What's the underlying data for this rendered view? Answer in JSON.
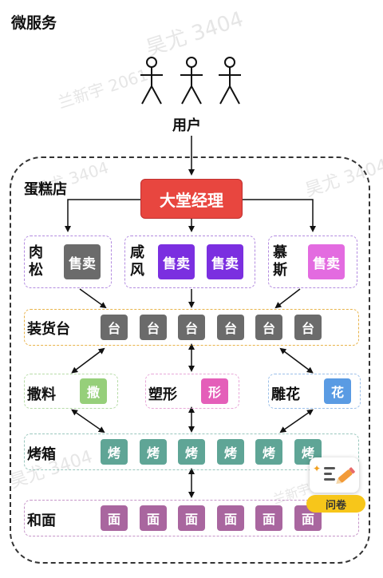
{
  "title": "微服务",
  "watermarks": [
    "昊尤 3404",
    "兰新宇 2061",
    "昊尤 3404",
    "昊尤 3404",
    "昊尤 3404",
    "兰新宇 2061"
  ],
  "users_label": "用户",
  "store_label": "蛋糕店",
  "manager_label": "大堂经理",
  "sellers": [
    {
      "name": "肉松",
      "tiles": [
        "售卖"
      ],
      "color": "#6b6b6b"
    },
    {
      "name": "咸风",
      "tiles": [
        "售卖",
        "售卖"
      ],
      "color": "#7b2fe0"
    },
    {
      "name": "慕斯",
      "tiles": [
        "售卖"
      ],
      "color": "#e36be0"
    }
  ],
  "store_row": {
    "label": "装货台",
    "tile": "台",
    "count": 6,
    "color": "#6b6b6b"
  },
  "stations": [
    {
      "name": "撒料",
      "tile": "撒",
      "color": "#96cf7a"
    },
    {
      "name": "塑形",
      "tile": "形",
      "color": "#e45fb9"
    },
    {
      "name": "雕花",
      "tile": "花",
      "color": "#5a9be3"
    }
  ],
  "oven_row": {
    "label": "烤箱",
    "tile": "烤",
    "count": 6,
    "color": "#5fa596"
  },
  "mix_row": {
    "label": "和面",
    "tile": "面",
    "count": 6,
    "color": "#a9669f"
  },
  "survey": {
    "button_label": "问卷"
  },
  "colors": {
    "manager": "#e8463f",
    "survey": "#f7c61a"
  }
}
